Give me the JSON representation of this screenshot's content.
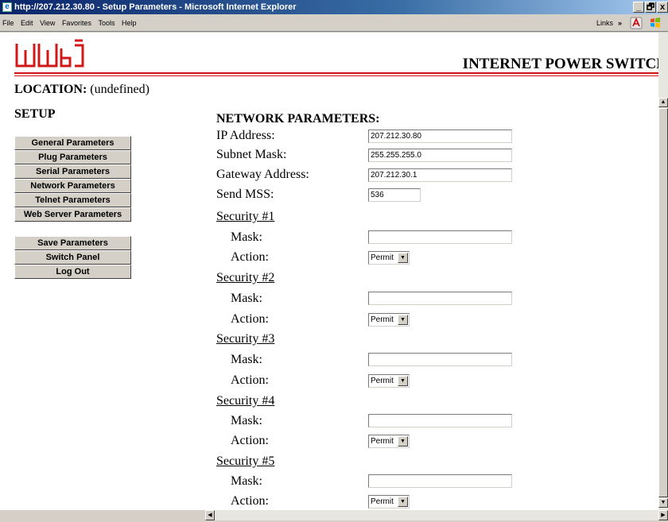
{
  "window": {
    "title": "http://207.212.30.80 - Setup Parameters - Microsoft Internet Explorer",
    "minimize": "_",
    "restore": "🗗",
    "close": "x"
  },
  "menubar": {
    "items": [
      "File",
      "Edit",
      "View",
      "Favorites",
      "Tools",
      "Help"
    ],
    "links_label": "Links",
    "chevron": "»"
  },
  "header": {
    "logo_text": "wti",
    "product_title": "INTERNET POWER SWITCH",
    "brand_color": "#d01818"
  },
  "location": {
    "label": "LOCATION:",
    "value": "(undefined)"
  },
  "setup": {
    "title": "SETUP",
    "menu1": [
      "General Parameters",
      "Plug Parameters",
      "Serial Parameters",
      "Network Parameters",
      "Telnet Parameters",
      "Web Server Parameters"
    ],
    "menu2": [
      "Save Parameters",
      "Switch Panel",
      "Log Out"
    ]
  },
  "network": {
    "title": "NETWORK PARAMETERS:",
    "ip_label": "IP Address:",
    "ip_value": "207.212.30.80",
    "subnet_label": "Subnet Mask:",
    "subnet_value": "255.255.255.0",
    "gateway_label": "Gateway Address:",
    "gateway_value": "207.212.30.1",
    "mss_label": "Send MSS:",
    "mss_value": "536",
    "mask_label": "Mask:",
    "action_label": "Action:",
    "security": [
      {
        "title": "Security #1",
        "mask": "",
        "action": "Permit"
      },
      {
        "title": "Security #2",
        "mask": "",
        "action": "Permit"
      },
      {
        "title": "Security #3",
        "mask": "",
        "action": "Permit"
      },
      {
        "title": "Security #4",
        "mask": "",
        "action": "Permit"
      },
      {
        "title": "Security #5",
        "mask": "",
        "action": "Permit"
      }
    ]
  }
}
